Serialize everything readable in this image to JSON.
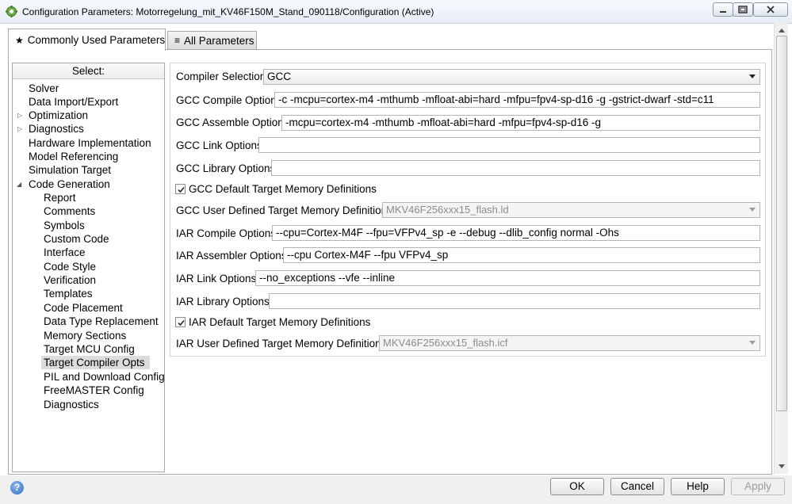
{
  "window": {
    "title": "Configuration Parameters: Motorregelung_mit_KV46F150M_Stand_090118/Configuration (Active)"
  },
  "tabs": [
    {
      "label": "Commonly Used Parameters",
      "icon": "star-icon",
      "active": true
    },
    {
      "label": "All Parameters",
      "icon": "list-icon",
      "active": false
    }
  ],
  "tree": {
    "header": "Select:",
    "items": [
      {
        "label": "Solver"
      },
      {
        "label": "Data Import/Export"
      },
      {
        "label": "Optimization",
        "expander": "collapsed"
      },
      {
        "label": "Diagnostics",
        "expander": "collapsed"
      },
      {
        "label": "Hardware Implementation"
      },
      {
        "label": "Model Referencing"
      },
      {
        "label": "Simulation Target"
      },
      {
        "label": "Code Generation",
        "expander": "expanded"
      },
      {
        "label": "Report"
      },
      {
        "label": "Comments"
      },
      {
        "label": "Symbols"
      },
      {
        "label": "Custom Code"
      },
      {
        "label": "Interface"
      },
      {
        "label": "Code Style"
      },
      {
        "label": "Verification"
      },
      {
        "label": "Templates"
      },
      {
        "label": "Code Placement"
      },
      {
        "label": "Data Type Replacement"
      },
      {
        "label": "Memory Sections"
      },
      {
        "label": "Target MCU Config"
      },
      {
        "label": "Target Compiler Opts",
        "selected": true
      },
      {
        "label": "PIL and Download Config"
      },
      {
        "label": "FreeMASTER Config"
      },
      {
        "label": "Diagnostics"
      }
    ]
  },
  "form": {
    "compiler_selection": {
      "label": "Compiler Selection",
      "value": "GCC"
    },
    "gcc_compile": {
      "label": "GCC Compile Options",
      "value": "-c -mcpu=cortex-m4 -mthumb -mfloat-abi=hard -mfpu=fpv4-sp-d16 -g -gstrict-dwarf -std=c11"
    },
    "gcc_assemble": {
      "label": "GCC Assemble Options",
      "value": "-mcpu=cortex-m4 -mthumb -mfloat-abi=hard -mfpu=fpv4-sp-d16 -g"
    },
    "gcc_link": {
      "label": "GCC Link Options",
      "value": ""
    },
    "gcc_library": {
      "label": "GCC Library Options",
      "value": ""
    },
    "gcc_default_mem": {
      "label": "GCC Default Target Memory Definitions",
      "checked": true
    },
    "gcc_user_mem": {
      "label": "GCC User Defined Target Memory Definitions",
      "value": "MKV46F256xxx15_flash.ld"
    },
    "iar_compile": {
      "label": "IAR Compile Options",
      "value": "--cpu=Cortex-M4F --fpu=VFPv4_sp -e --debug --dlib_config normal -Ohs"
    },
    "iar_assembler": {
      "label": "IAR Assembler Options",
      "value": "--cpu Cortex-M4F --fpu VFPv4_sp"
    },
    "iar_link": {
      "label": "IAR Link Options",
      "value": "--no_exceptions --vfe --inline"
    },
    "iar_library": {
      "label": "IAR Library Options",
      "value": ""
    },
    "iar_default_mem": {
      "label": "IAR Default Target Memory Definitions",
      "checked": true
    },
    "iar_user_mem": {
      "label": "IAR User Defined Target Memory Definitions",
      "value": "MKV46F256xxx15_flash.icf"
    }
  },
  "buttons": {
    "ok": "OK",
    "cancel": "Cancel",
    "help": "Help",
    "apply": "Apply",
    "help_icon_glyph": "?"
  }
}
